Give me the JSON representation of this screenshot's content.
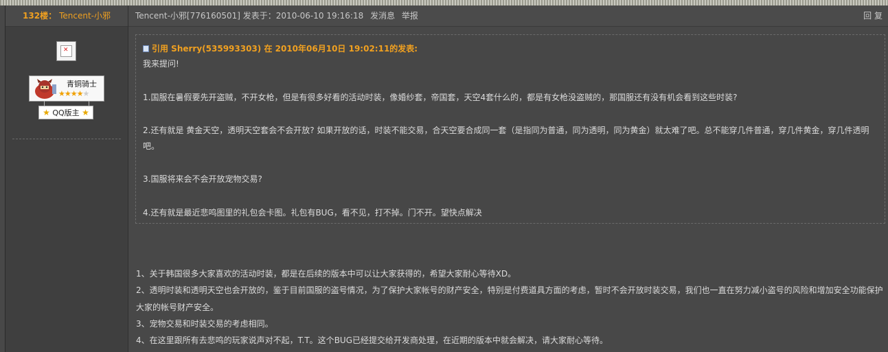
{
  "floor": {
    "number": "132楼：",
    "username": "Tencent-小邪"
  },
  "user": {
    "rank_title": "青铜骑士",
    "stars_filled": "★★★★",
    "stars_empty": "★",
    "badge": "QQ版主"
  },
  "post_header": {
    "meta": "Tencent-小邪[776160501] 发表于：2010-06-10 19:16:18",
    "message_link": "发消息",
    "report_link": "举报",
    "reply_link": "回 复"
  },
  "quote": {
    "header": "引用 Sherry(535993303) 在 2010年06月10日 19:02:11的发表:",
    "lines": [
      "我来提问!",
      "1.国服在暑假要先开盗贼，不开女枪，但是有很多好看的活动时装，像婚纱套，帝国套，天空4套什么的，都是有女枪没盗贼的，那国服还有没有机会看到这些时装?",
      "2.还有就是 黄金天空，透明天空套会不会开放? 如果开放的话，时装不能交易，合天空要合成同一套（是指同为普通，同为透明，同为黄金）就太难了吧。总不能穿几件普通，穿几件黄金，穿几件透明",
      "吧。",
      "3.国服将来会不会开放宠物交易?",
      "4.还有就是最近悲鸣图里的礼包会卡图。礼包有BUG，看不见，打不掉。门不开。望快点解决"
    ]
  },
  "answer": {
    "lines": [
      "1、关于韩国很多大家喜欢的活动时装，都是在后续的版本中可以让大家获得的，希望大家耐心等待XD。",
      "2、透明时装和透明天空也会开放的，鉴于目前国服的盗号情况，为了保护大家帐号的财产安全，特别是付费道具方面的考虑，暂时不会开放时装交易，我们也一直在努力减小盗号的风险和增加安全功能保护",
      "大家的帐号财产安全。",
      "3、宠物交易和时装交易的考虑相同。",
      "4、在这里跟所有去悲鸣的玩家说声对不起，T.T。这个BUG已经提交给开发商处理，在近期的版本中就会解决，请大家耐心等待。"
    ]
  }
}
